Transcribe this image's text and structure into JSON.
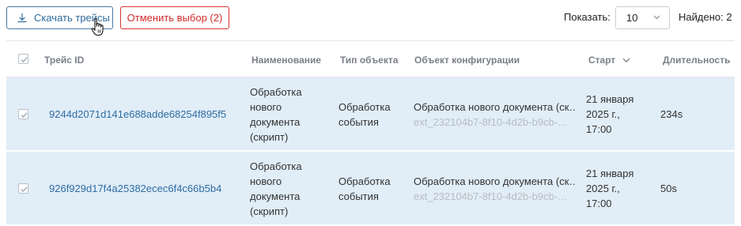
{
  "toolbar": {
    "download_label": "Скачать трейсы",
    "cancel_label": "Отменить выбор (2)",
    "show_label": "Показать:",
    "page_size": "10",
    "found_label": "Найдено:",
    "found_count": "2"
  },
  "table": {
    "headers": {
      "trace_id": "Трейс ID",
      "name": "Наименование",
      "object_type": "Тип объекта",
      "config_object": "Объект конфигурации",
      "start": "Старт",
      "duration": "Длительность"
    },
    "rows": [
      {
        "trace_id": "9244d2071d141e688adde68254f895f5",
        "name": [
          "Обработка",
          "нового",
          "документа",
          "(скрипт)"
        ],
        "object_type": [
          "Обработка",
          "события"
        ],
        "config_title": "Обработка нового документа (ск…",
        "config_id": "ext_232104b7-8f10-4d2b-b9cb-…",
        "start": [
          "21 января",
          "2025 г.,",
          "17:00"
        ],
        "duration": "234s",
        "checked": true
      },
      {
        "trace_id": "926f929d17f4a25382ecec6f4c66b5b4",
        "name": [
          "Обработка",
          "нового",
          "документа",
          "(скрипт)"
        ],
        "object_type": [
          "Обработка",
          "события"
        ],
        "config_title": "Обработка нового документа (ск…",
        "config_id": "ext_232104b7-8f10-4d2b-b9cb-…",
        "start": [
          "21 января",
          "2025 г.,",
          "17:00"
        ],
        "duration": "50s",
        "checked": true
      }
    ]
  },
  "colors": {
    "accent": "#2d6da3",
    "danger": "#d12a2a",
    "row_selected_bg": "#e1edf7",
    "header_text": "#7a7f87"
  }
}
